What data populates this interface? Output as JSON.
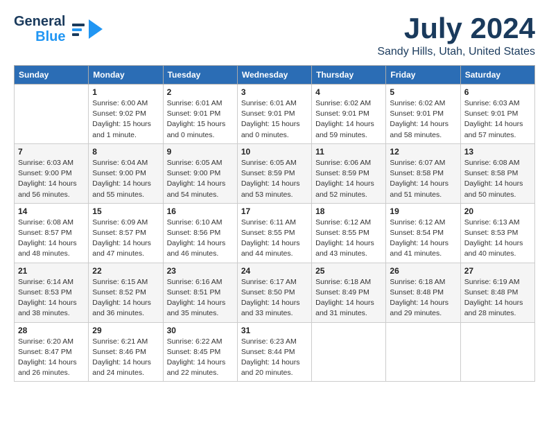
{
  "header": {
    "logo": {
      "line1": "General",
      "line2": "Blue"
    },
    "title": "July 2024",
    "subtitle": "Sandy Hills, Utah, United States"
  },
  "calendar": {
    "days": [
      "Sunday",
      "Monday",
      "Tuesday",
      "Wednesday",
      "Thursday",
      "Friday",
      "Saturday"
    ],
    "weeks": [
      [
        {
          "num": "",
          "info": ""
        },
        {
          "num": "1",
          "info": "Sunrise: 6:00 AM\nSunset: 9:02 PM\nDaylight: 15 hours\nand 1 minute."
        },
        {
          "num": "2",
          "info": "Sunrise: 6:01 AM\nSunset: 9:01 PM\nDaylight: 15 hours\nand 0 minutes."
        },
        {
          "num": "3",
          "info": "Sunrise: 6:01 AM\nSunset: 9:01 PM\nDaylight: 15 hours\nand 0 minutes."
        },
        {
          "num": "4",
          "info": "Sunrise: 6:02 AM\nSunset: 9:01 PM\nDaylight: 14 hours\nand 59 minutes."
        },
        {
          "num": "5",
          "info": "Sunrise: 6:02 AM\nSunset: 9:01 PM\nDaylight: 14 hours\nand 58 minutes."
        },
        {
          "num": "6",
          "info": "Sunrise: 6:03 AM\nSunset: 9:01 PM\nDaylight: 14 hours\nand 57 minutes."
        }
      ],
      [
        {
          "num": "7",
          "info": "Sunrise: 6:03 AM\nSunset: 9:00 PM\nDaylight: 14 hours\nand 56 minutes."
        },
        {
          "num": "8",
          "info": "Sunrise: 6:04 AM\nSunset: 9:00 PM\nDaylight: 14 hours\nand 55 minutes."
        },
        {
          "num": "9",
          "info": "Sunrise: 6:05 AM\nSunset: 9:00 PM\nDaylight: 14 hours\nand 54 minutes."
        },
        {
          "num": "10",
          "info": "Sunrise: 6:05 AM\nSunset: 8:59 PM\nDaylight: 14 hours\nand 53 minutes."
        },
        {
          "num": "11",
          "info": "Sunrise: 6:06 AM\nSunset: 8:59 PM\nDaylight: 14 hours\nand 52 minutes."
        },
        {
          "num": "12",
          "info": "Sunrise: 6:07 AM\nSunset: 8:58 PM\nDaylight: 14 hours\nand 51 minutes."
        },
        {
          "num": "13",
          "info": "Sunrise: 6:08 AM\nSunset: 8:58 PM\nDaylight: 14 hours\nand 50 minutes."
        }
      ],
      [
        {
          "num": "14",
          "info": "Sunrise: 6:08 AM\nSunset: 8:57 PM\nDaylight: 14 hours\nand 48 minutes."
        },
        {
          "num": "15",
          "info": "Sunrise: 6:09 AM\nSunset: 8:57 PM\nDaylight: 14 hours\nand 47 minutes."
        },
        {
          "num": "16",
          "info": "Sunrise: 6:10 AM\nSunset: 8:56 PM\nDaylight: 14 hours\nand 46 minutes."
        },
        {
          "num": "17",
          "info": "Sunrise: 6:11 AM\nSunset: 8:55 PM\nDaylight: 14 hours\nand 44 minutes."
        },
        {
          "num": "18",
          "info": "Sunrise: 6:12 AM\nSunset: 8:55 PM\nDaylight: 14 hours\nand 43 minutes."
        },
        {
          "num": "19",
          "info": "Sunrise: 6:12 AM\nSunset: 8:54 PM\nDaylight: 14 hours\nand 41 minutes."
        },
        {
          "num": "20",
          "info": "Sunrise: 6:13 AM\nSunset: 8:53 PM\nDaylight: 14 hours\nand 40 minutes."
        }
      ],
      [
        {
          "num": "21",
          "info": "Sunrise: 6:14 AM\nSunset: 8:53 PM\nDaylight: 14 hours\nand 38 minutes."
        },
        {
          "num": "22",
          "info": "Sunrise: 6:15 AM\nSunset: 8:52 PM\nDaylight: 14 hours\nand 36 minutes."
        },
        {
          "num": "23",
          "info": "Sunrise: 6:16 AM\nSunset: 8:51 PM\nDaylight: 14 hours\nand 35 minutes."
        },
        {
          "num": "24",
          "info": "Sunrise: 6:17 AM\nSunset: 8:50 PM\nDaylight: 14 hours\nand 33 minutes."
        },
        {
          "num": "25",
          "info": "Sunrise: 6:18 AM\nSunset: 8:49 PM\nDaylight: 14 hours\nand 31 minutes."
        },
        {
          "num": "26",
          "info": "Sunrise: 6:18 AM\nSunset: 8:48 PM\nDaylight: 14 hours\nand 29 minutes."
        },
        {
          "num": "27",
          "info": "Sunrise: 6:19 AM\nSunset: 8:48 PM\nDaylight: 14 hours\nand 28 minutes."
        }
      ],
      [
        {
          "num": "28",
          "info": "Sunrise: 6:20 AM\nSunset: 8:47 PM\nDaylight: 14 hours\nand 26 minutes."
        },
        {
          "num": "29",
          "info": "Sunrise: 6:21 AM\nSunset: 8:46 PM\nDaylight: 14 hours\nand 24 minutes."
        },
        {
          "num": "30",
          "info": "Sunrise: 6:22 AM\nSunset: 8:45 PM\nDaylight: 14 hours\nand 22 minutes."
        },
        {
          "num": "31",
          "info": "Sunrise: 6:23 AM\nSunset: 8:44 PM\nDaylight: 14 hours\nand 20 minutes."
        },
        {
          "num": "",
          "info": ""
        },
        {
          "num": "",
          "info": ""
        },
        {
          "num": "",
          "info": ""
        }
      ]
    ]
  }
}
